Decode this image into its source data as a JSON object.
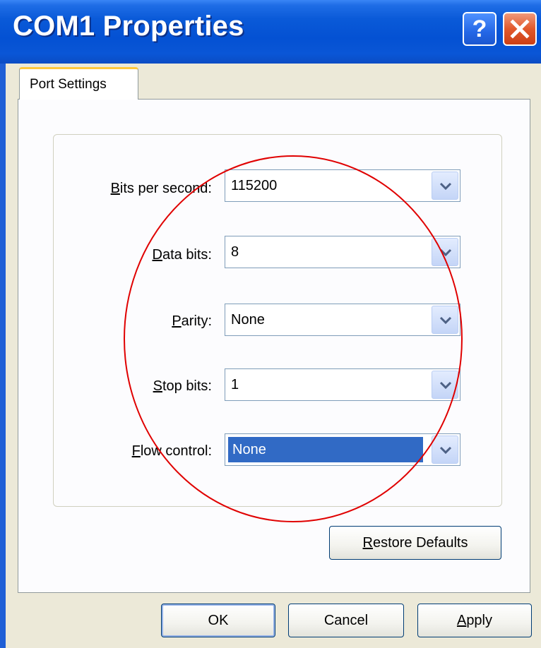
{
  "window": {
    "title": "COM1 Properties",
    "help_button": "?",
    "close_icon": "close-x-icon"
  },
  "tabs": [
    {
      "label": "Port Settings",
      "active": true
    }
  ],
  "fields": {
    "bits_per_second": {
      "label_access": "B",
      "label_rest": "its per second:",
      "value": "115200"
    },
    "data_bits": {
      "label_access": "D",
      "label_rest": "ata bits:",
      "value": "8"
    },
    "parity": {
      "label_access": "P",
      "label_rest": "arity:",
      "value": "None"
    },
    "stop_bits": {
      "label_access": "S",
      "label_rest": "top bits:",
      "value": "1"
    },
    "flow_control": {
      "label_access": "F",
      "label_rest": "low control:",
      "value": "None",
      "selected": true
    }
  },
  "buttons": {
    "restore_access": "R",
    "restore_rest": "estore Defaults",
    "ok": "OK",
    "cancel": "Cancel",
    "apply_access": "A",
    "apply_rest": "pply"
  },
  "colors": {
    "title_bar": "#0451d3",
    "selection": "#316ac5",
    "annotation": "#e00000",
    "tab_highlight": "#ffc83c"
  }
}
